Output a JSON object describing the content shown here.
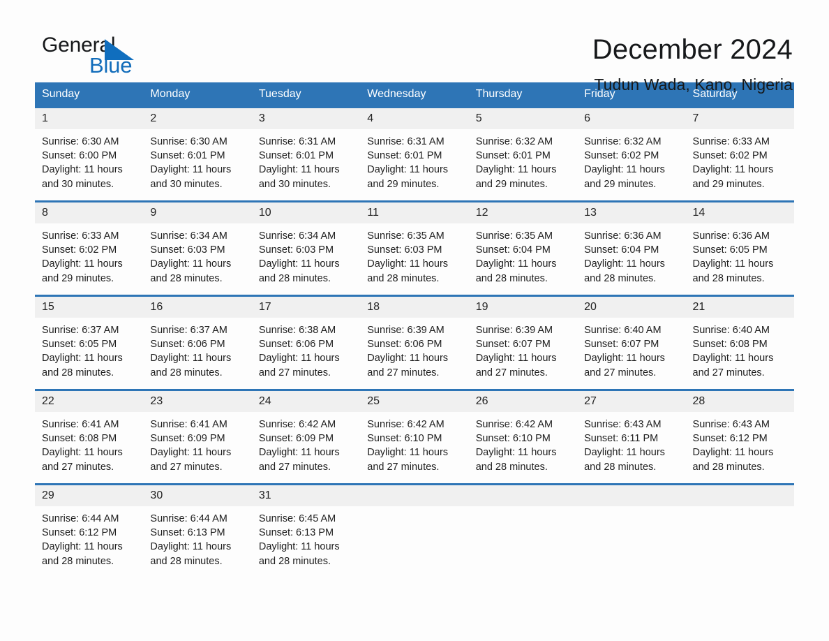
{
  "brand": {
    "name_part1": "General",
    "name_part2": "Blue",
    "accent_color": "#116cba"
  },
  "header": {
    "month_title": "December 2024",
    "location": "Tudun Wada, Kano, Nigeria"
  },
  "colors": {
    "header_bar": "#2e75b6",
    "day_banner": "#f0f0f0",
    "page_bg": "#fdfdfd"
  },
  "weekday_headers": [
    "Sunday",
    "Monday",
    "Tuesday",
    "Wednesday",
    "Thursday",
    "Friday",
    "Saturday"
  ],
  "weeks": [
    [
      {
        "day": "1",
        "sunrise": "Sunrise: 6:30 AM",
        "sunset": "Sunset: 6:00 PM",
        "daylight_line1": "Daylight: 11 hours",
        "daylight_line2": "and 30 minutes."
      },
      {
        "day": "2",
        "sunrise": "Sunrise: 6:30 AM",
        "sunset": "Sunset: 6:01 PM",
        "daylight_line1": "Daylight: 11 hours",
        "daylight_line2": "and 30 minutes."
      },
      {
        "day": "3",
        "sunrise": "Sunrise: 6:31 AM",
        "sunset": "Sunset: 6:01 PM",
        "daylight_line1": "Daylight: 11 hours",
        "daylight_line2": "and 30 minutes."
      },
      {
        "day": "4",
        "sunrise": "Sunrise: 6:31 AM",
        "sunset": "Sunset: 6:01 PM",
        "daylight_line1": "Daylight: 11 hours",
        "daylight_line2": "and 29 minutes."
      },
      {
        "day": "5",
        "sunrise": "Sunrise: 6:32 AM",
        "sunset": "Sunset: 6:01 PM",
        "daylight_line1": "Daylight: 11 hours",
        "daylight_line2": "and 29 minutes."
      },
      {
        "day": "6",
        "sunrise": "Sunrise: 6:32 AM",
        "sunset": "Sunset: 6:02 PM",
        "daylight_line1": "Daylight: 11 hours",
        "daylight_line2": "and 29 minutes."
      },
      {
        "day": "7",
        "sunrise": "Sunrise: 6:33 AM",
        "sunset": "Sunset: 6:02 PM",
        "daylight_line1": "Daylight: 11 hours",
        "daylight_line2": "and 29 minutes."
      }
    ],
    [
      {
        "day": "8",
        "sunrise": "Sunrise: 6:33 AM",
        "sunset": "Sunset: 6:02 PM",
        "daylight_line1": "Daylight: 11 hours",
        "daylight_line2": "and 29 minutes."
      },
      {
        "day": "9",
        "sunrise": "Sunrise: 6:34 AM",
        "sunset": "Sunset: 6:03 PM",
        "daylight_line1": "Daylight: 11 hours",
        "daylight_line2": "and 28 minutes."
      },
      {
        "day": "10",
        "sunrise": "Sunrise: 6:34 AM",
        "sunset": "Sunset: 6:03 PM",
        "daylight_line1": "Daylight: 11 hours",
        "daylight_line2": "and 28 minutes."
      },
      {
        "day": "11",
        "sunrise": "Sunrise: 6:35 AM",
        "sunset": "Sunset: 6:03 PM",
        "daylight_line1": "Daylight: 11 hours",
        "daylight_line2": "and 28 minutes."
      },
      {
        "day": "12",
        "sunrise": "Sunrise: 6:35 AM",
        "sunset": "Sunset: 6:04 PM",
        "daylight_line1": "Daylight: 11 hours",
        "daylight_line2": "and 28 minutes."
      },
      {
        "day": "13",
        "sunrise": "Sunrise: 6:36 AM",
        "sunset": "Sunset: 6:04 PM",
        "daylight_line1": "Daylight: 11 hours",
        "daylight_line2": "and 28 minutes."
      },
      {
        "day": "14",
        "sunrise": "Sunrise: 6:36 AM",
        "sunset": "Sunset: 6:05 PM",
        "daylight_line1": "Daylight: 11 hours",
        "daylight_line2": "and 28 minutes."
      }
    ],
    [
      {
        "day": "15",
        "sunrise": "Sunrise: 6:37 AM",
        "sunset": "Sunset: 6:05 PM",
        "daylight_line1": "Daylight: 11 hours",
        "daylight_line2": "and 28 minutes."
      },
      {
        "day": "16",
        "sunrise": "Sunrise: 6:37 AM",
        "sunset": "Sunset: 6:06 PM",
        "daylight_line1": "Daylight: 11 hours",
        "daylight_line2": "and 28 minutes."
      },
      {
        "day": "17",
        "sunrise": "Sunrise: 6:38 AM",
        "sunset": "Sunset: 6:06 PM",
        "daylight_line1": "Daylight: 11 hours",
        "daylight_line2": "and 27 minutes."
      },
      {
        "day": "18",
        "sunrise": "Sunrise: 6:39 AM",
        "sunset": "Sunset: 6:06 PM",
        "daylight_line1": "Daylight: 11 hours",
        "daylight_line2": "and 27 minutes."
      },
      {
        "day": "19",
        "sunrise": "Sunrise: 6:39 AM",
        "sunset": "Sunset: 6:07 PM",
        "daylight_line1": "Daylight: 11 hours",
        "daylight_line2": "and 27 minutes."
      },
      {
        "day": "20",
        "sunrise": "Sunrise: 6:40 AM",
        "sunset": "Sunset: 6:07 PM",
        "daylight_line1": "Daylight: 11 hours",
        "daylight_line2": "and 27 minutes."
      },
      {
        "day": "21",
        "sunrise": "Sunrise: 6:40 AM",
        "sunset": "Sunset: 6:08 PM",
        "daylight_line1": "Daylight: 11 hours",
        "daylight_line2": "and 27 minutes."
      }
    ],
    [
      {
        "day": "22",
        "sunrise": "Sunrise: 6:41 AM",
        "sunset": "Sunset: 6:08 PM",
        "daylight_line1": "Daylight: 11 hours",
        "daylight_line2": "and 27 minutes."
      },
      {
        "day": "23",
        "sunrise": "Sunrise: 6:41 AM",
        "sunset": "Sunset: 6:09 PM",
        "daylight_line1": "Daylight: 11 hours",
        "daylight_line2": "and 27 minutes."
      },
      {
        "day": "24",
        "sunrise": "Sunrise: 6:42 AM",
        "sunset": "Sunset: 6:09 PM",
        "daylight_line1": "Daylight: 11 hours",
        "daylight_line2": "and 27 minutes."
      },
      {
        "day": "25",
        "sunrise": "Sunrise: 6:42 AM",
        "sunset": "Sunset: 6:10 PM",
        "daylight_line1": "Daylight: 11 hours",
        "daylight_line2": "and 27 minutes."
      },
      {
        "day": "26",
        "sunrise": "Sunrise: 6:42 AM",
        "sunset": "Sunset: 6:10 PM",
        "daylight_line1": "Daylight: 11 hours",
        "daylight_line2": "and 28 minutes."
      },
      {
        "day": "27",
        "sunrise": "Sunrise: 6:43 AM",
        "sunset": "Sunset: 6:11 PM",
        "daylight_line1": "Daylight: 11 hours",
        "daylight_line2": "and 28 minutes."
      },
      {
        "day": "28",
        "sunrise": "Sunrise: 6:43 AM",
        "sunset": "Sunset: 6:12 PM",
        "daylight_line1": "Daylight: 11 hours",
        "daylight_line2": "and 28 minutes."
      }
    ],
    [
      {
        "day": "29",
        "sunrise": "Sunrise: 6:44 AM",
        "sunset": "Sunset: 6:12 PM",
        "daylight_line1": "Daylight: 11 hours",
        "daylight_line2": "and 28 minutes."
      },
      {
        "day": "30",
        "sunrise": "Sunrise: 6:44 AM",
        "sunset": "Sunset: 6:13 PM",
        "daylight_line1": "Daylight: 11 hours",
        "daylight_line2": "and 28 minutes."
      },
      {
        "day": "31",
        "sunrise": "Sunrise: 6:45 AM",
        "sunset": "Sunset: 6:13 PM",
        "daylight_line1": "Daylight: 11 hours",
        "daylight_line2": "and 28 minutes."
      },
      {
        "day": "",
        "sunrise": "",
        "sunset": "",
        "daylight_line1": "",
        "daylight_line2": ""
      },
      {
        "day": "",
        "sunrise": "",
        "sunset": "",
        "daylight_line1": "",
        "daylight_line2": ""
      },
      {
        "day": "",
        "sunrise": "",
        "sunset": "",
        "daylight_line1": "",
        "daylight_line2": ""
      },
      {
        "day": "",
        "sunrise": "",
        "sunset": "",
        "daylight_line1": "",
        "daylight_line2": ""
      }
    ]
  ]
}
